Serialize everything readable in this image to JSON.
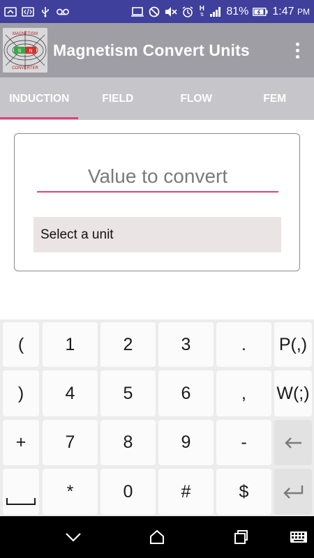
{
  "status_bar": {
    "battery": "81%",
    "time": "1:47",
    "ampm": "PM",
    "network": "H",
    "icons": [
      "sync-icon",
      "code-icon",
      "usb-icon",
      "voicemail-icon",
      "cast-icon",
      "do-not-disturb-icon",
      "mute-icon",
      "alarm-icon",
      "network-h-icon",
      "signal-icon",
      "battery-charging-icon"
    ]
  },
  "app_bar": {
    "title": "Magnetism Convert Units",
    "logo_icon": "magnet-converter-logo-icon",
    "logo_text_top": "MAGNETISM",
    "logo_text_bottom": "CONVERTER",
    "logo_pole_s": "S",
    "logo_pole_n": "N"
  },
  "tabs": [
    {
      "label": "INDUCTION",
      "active": true
    },
    {
      "label": "FIELD",
      "active": false
    },
    {
      "label": "FLOW",
      "active": false
    },
    {
      "label": "FEM",
      "active": false
    }
  ],
  "form": {
    "value_placeholder": "Value to convert",
    "value": "",
    "unit_select": "Select a unit"
  },
  "keyboard": {
    "rows": [
      [
        "(",
        "1",
        "2",
        "3",
        ".",
        "P(,)"
      ],
      [
        ")",
        "4",
        "5",
        "6",
        ",",
        "W(;)"
      ],
      [
        "+",
        "7",
        "8",
        "9",
        "-",
        "backspace-icon"
      ],
      [
        "space-icon",
        "*",
        "0",
        "#",
        "$",
        "enter-icon"
      ]
    ]
  },
  "nav_bar": {
    "icons": [
      "back-icon",
      "home-icon",
      "recents-icon",
      "keyboard-icon"
    ]
  },
  "colors": {
    "status_bar": "#3f3f9c",
    "app_bar": "#9e9ea4",
    "tabs": "#c6c6ca",
    "accent": "#e0407a",
    "select_bg": "#ebe4e4"
  }
}
